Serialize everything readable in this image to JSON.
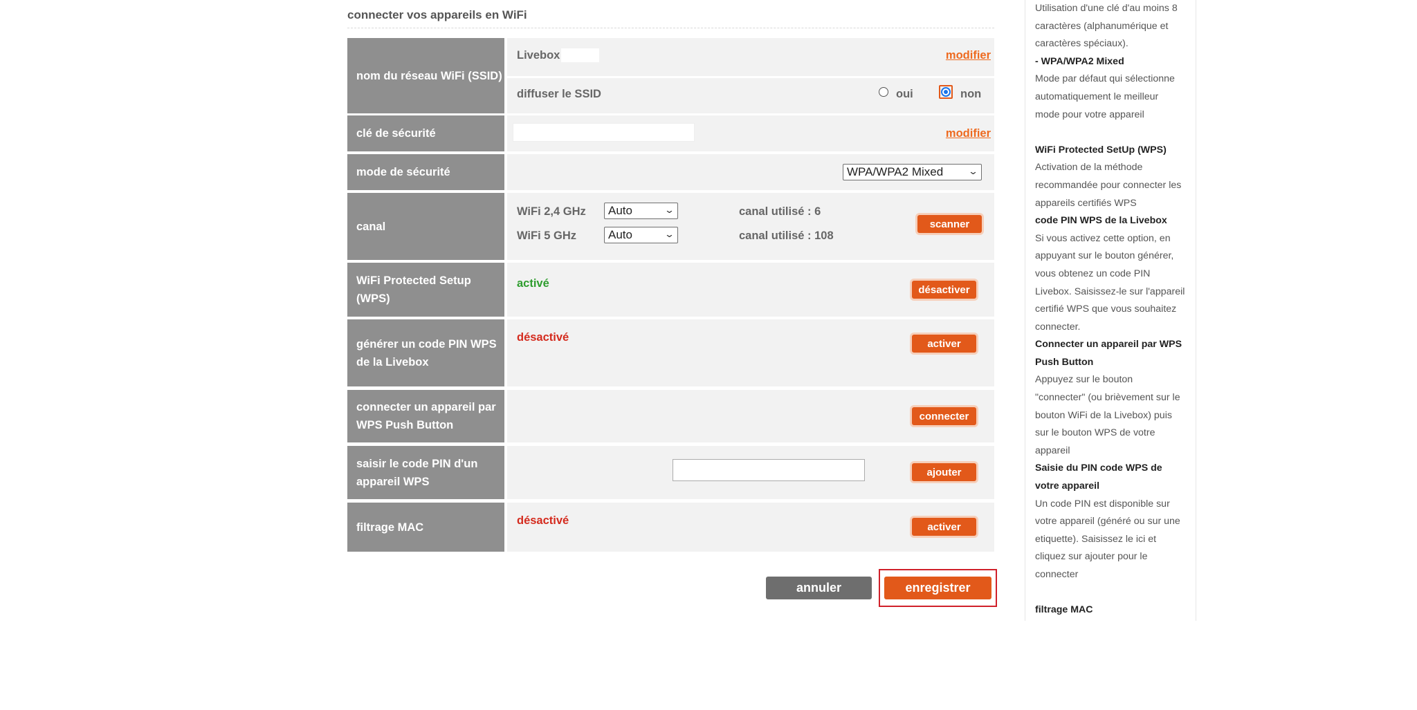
{
  "section_title": "connecter vos appareils en WiFi",
  "ssid": {
    "label": "nom du réseau WiFi (SSID)",
    "value": "Livebox",
    "modify_link": "modifier",
    "broadcast_label": "diffuser le SSID",
    "option_yes": "oui",
    "option_no": "non",
    "selected": "non"
  },
  "security_key": {
    "label": "clé de sécurité",
    "value": "",
    "modify_link": "modifier"
  },
  "security_mode": {
    "label": "mode de sécurité",
    "selected": "WPA/WPA2 Mixed"
  },
  "channel": {
    "label": "canal",
    "band_24": {
      "name": "WiFi 2,4 GHz",
      "selected": "Auto",
      "used": "canal utilisé : 6"
    },
    "band_5": {
      "name": "WiFi 5 GHz",
      "selected": "Auto",
      "used": "canal utilisé : 108"
    },
    "scan_button": "scanner"
  },
  "wps": {
    "label": "WiFi Protected Setup (WPS)",
    "status": "activé",
    "button": "désactiver"
  },
  "wps_pin": {
    "label": "générer un code PIN WPS de la Livebox",
    "status": "désactivé",
    "button": "activer"
  },
  "wps_push": {
    "label": "connecter un appareil par WPS Push Button",
    "button": "connecter"
  },
  "device_pin": {
    "label": "saisir le code PIN d'un appareil WPS",
    "value": "",
    "button": "ajouter"
  },
  "mac_filter": {
    "label": "filtrage MAC",
    "status": "désactivé",
    "button": "activer"
  },
  "actions": {
    "cancel": "annuler",
    "save": "enregistrer"
  },
  "help": {
    "key_text_1": "Utilisation d'une clé d'au moins 8",
    "key_text_2": "caractères (alphanumérique et",
    "key_text_3": "caractères spéciaux).",
    "mixed_heading": "- WPA/WPA2 Mixed",
    "mixed_text_1": "Mode par défaut qui sélectionne",
    "mixed_text_2": "automatiquement le meilleur",
    "mixed_text_3": "mode pour votre appareil",
    "wps_heading": "WiFi Protected SetUp (WPS)",
    "wps_text_1": "Activation de la méthode",
    "wps_text_2": "recommandée pour connecter les",
    "wps_text_3": "appareils certifiés WPS",
    "pin_heading": "code PIN WPS de la Livebox",
    "pin_text_1": "Si vous activez cette option, en",
    "pin_text_2": "appuyant sur le bouton générer,",
    "pin_text_3": "vous obtenez un code PIN",
    "pin_text_4": "Livebox. Saisissez-le sur l'appareil",
    "pin_text_5": "certifié WPS que vous souhaitez",
    "pin_text_6": "connecter.",
    "push_heading_1": "Connecter un appareil par WPS",
    "push_heading_2": "Push Button",
    "push_text_1": "Appuyez sur le bouton",
    "push_text_2": "\"connecter\" (ou brièvement sur le",
    "push_text_3": "bouton WiFi de la Livebox) puis",
    "push_text_4": "sur le bouton WPS de votre",
    "push_text_5": "appareil",
    "device_heading_1": "Saisie du PIN code WPS de",
    "device_heading_2": "votre appareil",
    "device_text_1": "Un code PIN est disponible sur",
    "device_text_2": "votre appareil (généré ou sur une",
    "device_text_3": "etiquette). Saisissez le ici et",
    "device_text_4": "cliquez sur ajouter pour le",
    "device_text_5": "connecter",
    "mac_heading": "filtrage MAC"
  }
}
